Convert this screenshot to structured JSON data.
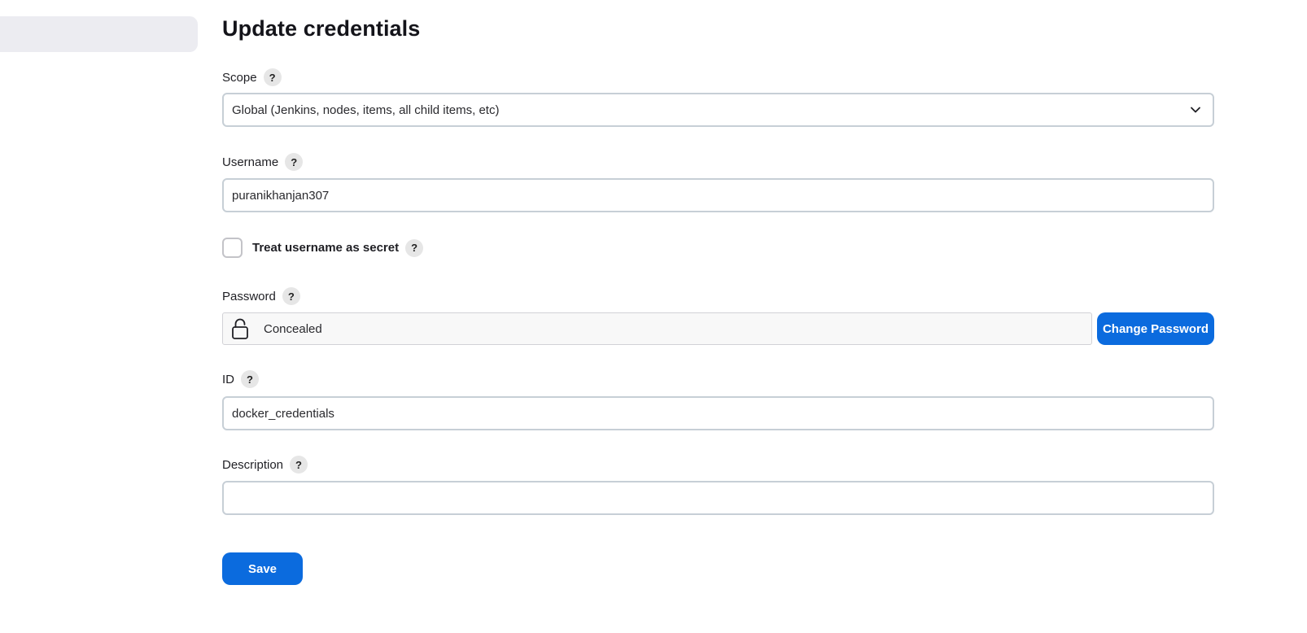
{
  "page": {
    "title": "Update credentials"
  },
  "help_glyph": "?",
  "scope": {
    "label": "Scope",
    "selected": "Global (Jenkins, nodes, items, all child items, etc)"
  },
  "username": {
    "label": "Username",
    "value": "puranikhanjan307"
  },
  "treat_username_secret": {
    "label": "Treat username as secret",
    "checked": false
  },
  "password": {
    "label": "Password",
    "status": "Concealed",
    "change_label": "Change Password"
  },
  "id_field": {
    "label": "ID",
    "value": "docker_credentials"
  },
  "description": {
    "label": "Description",
    "value": ""
  },
  "save_label": "Save",
  "icons": {
    "scope_dropdown": "chevron-down-icon",
    "password_lock": "lock-icon"
  },
  "colors": {
    "primary_button": "#0b6bde",
    "sidebar_pill": "#ececf1",
    "field_border": "#c7cfd6",
    "concealed_background": "#f8f8f8"
  }
}
